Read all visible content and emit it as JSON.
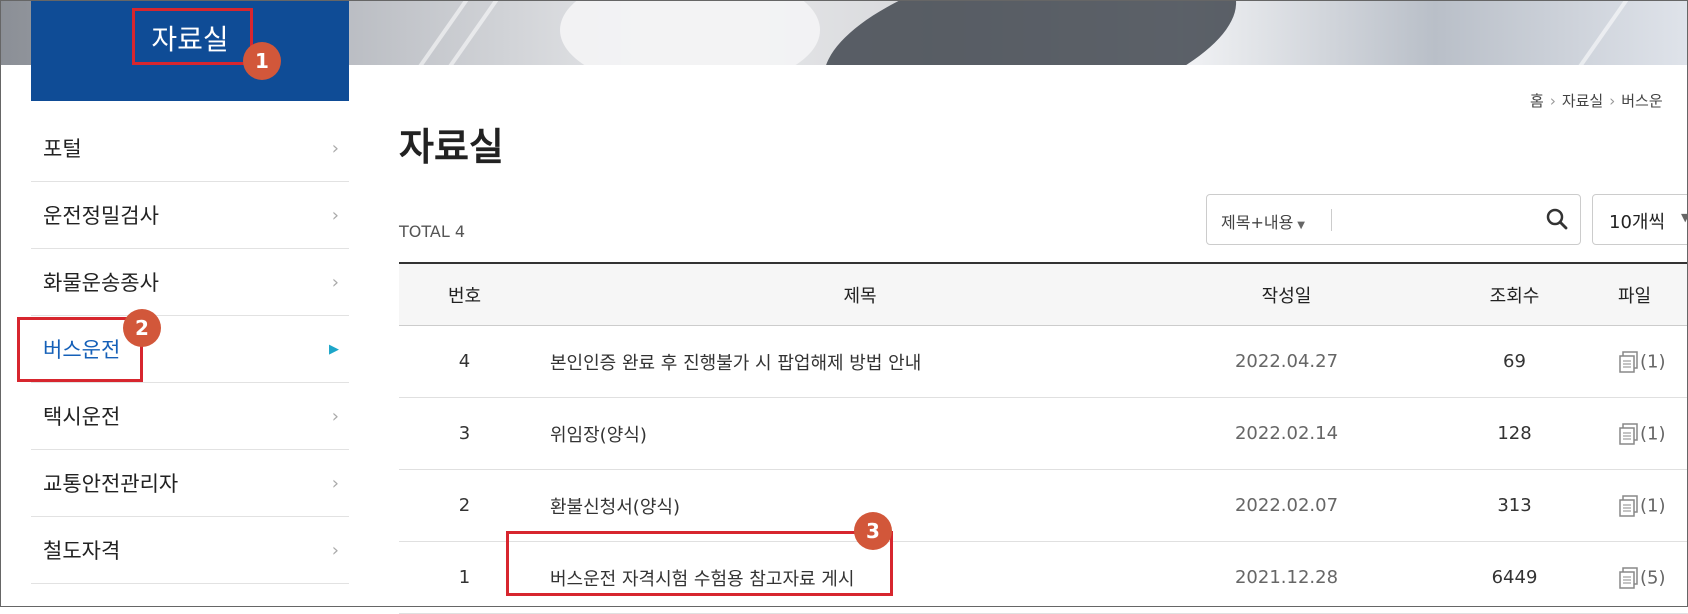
{
  "sidebar": {
    "header": "자료실",
    "items": [
      {
        "label": "포털",
        "active": false
      },
      {
        "label": "운전정밀검사",
        "active": false
      },
      {
        "label": "화물운송종사",
        "active": false
      },
      {
        "label": "버스운전",
        "active": true
      },
      {
        "label": "택시운전",
        "active": false
      },
      {
        "label": "교통안전관리자",
        "active": false
      },
      {
        "label": "철도자격",
        "active": false
      }
    ]
  },
  "breadcrumb": {
    "home": "홈",
    "level1": "자료실",
    "level2": "버스운"
  },
  "page": {
    "title": "자료실",
    "total": "TOTAL 4"
  },
  "search": {
    "scope": "제목+내용",
    "value": "",
    "per_page": "10개씩"
  },
  "table": {
    "headers": {
      "no": "번호",
      "title": "제목",
      "date": "작성일",
      "views": "조회수",
      "file": "파일"
    },
    "rows": [
      {
        "no": "4",
        "title": "본인인증 완료 후 진행불가 시 팝업해제 방법 안내",
        "date": "2022.04.27",
        "views": "69",
        "files": "(1)"
      },
      {
        "no": "3",
        "title": "위임장(양식)",
        "date": "2022.02.14",
        "views": "128",
        "files": "(1)"
      },
      {
        "no": "2",
        "title": "환불신청서(양식)",
        "date": "2022.02.07",
        "views": "313",
        "files": "(1)"
      },
      {
        "no": "1",
        "title": "버스운전 자격시험 수험용 참고자료 게시",
        "date": "2021.12.28",
        "views": "6449",
        "files": "(5)"
      }
    ]
  },
  "annotations": [
    "1",
    "2",
    "3"
  ],
  "colors": {
    "sidebar_header": "#0f4c96",
    "active_item": "#1560b8",
    "annotation": "#d7262e",
    "badge": "#d2573a"
  }
}
